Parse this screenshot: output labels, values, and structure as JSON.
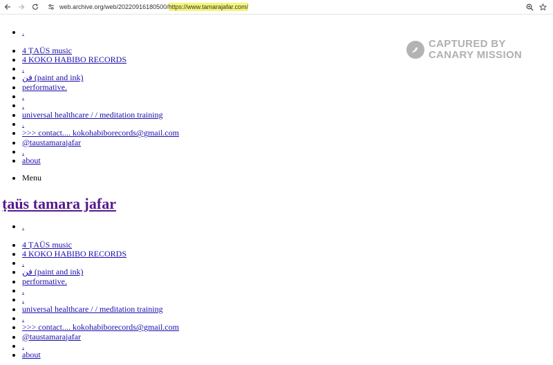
{
  "browser": {
    "url_prefix": "web.archive.org/web/20220916180500/",
    "url_highlight": "https://www.tamarajafar.com/",
    "back_icon": "arrow-left-icon",
    "forward_icon": "arrow-right-icon",
    "reload_icon": "reload-icon",
    "site_info_icon": "tune-icon",
    "zoom_icon": "zoom-icon",
    "bookmark_icon": "star-icon",
    "highlight_color": "#f5f57a"
  },
  "watermark": {
    "line1": "CAPTURED BY",
    "line2": "CANARY MISSION"
  },
  "nav": {
    "items": [
      {
        "label": "."
      },
      {
        "label": "4 ṬAÜS music"
      },
      {
        "label": "4 KOKO HABIBO RECORDS"
      },
      {
        "label": "."
      },
      {
        "label": "ﻓﻦ (paint and ink)"
      },
      {
        "label": "performative."
      },
      {
        "label": "."
      },
      {
        "label": "."
      },
      {
        "label": "universal healthcare / / meditation training"
      },
      {
        "label": "."
      },
      {
        "label": ">>> contact.... kokohabiborecords@gmail.com"
      },
      {
        "label": "@taustamarajafar"
      },
      {
        "label": "."
      },
      {
        "label": "about"
      }
    ],
    "menu_label": "Menu"
  },
  "site_title": "ṭaüs tamara jafar"
}
